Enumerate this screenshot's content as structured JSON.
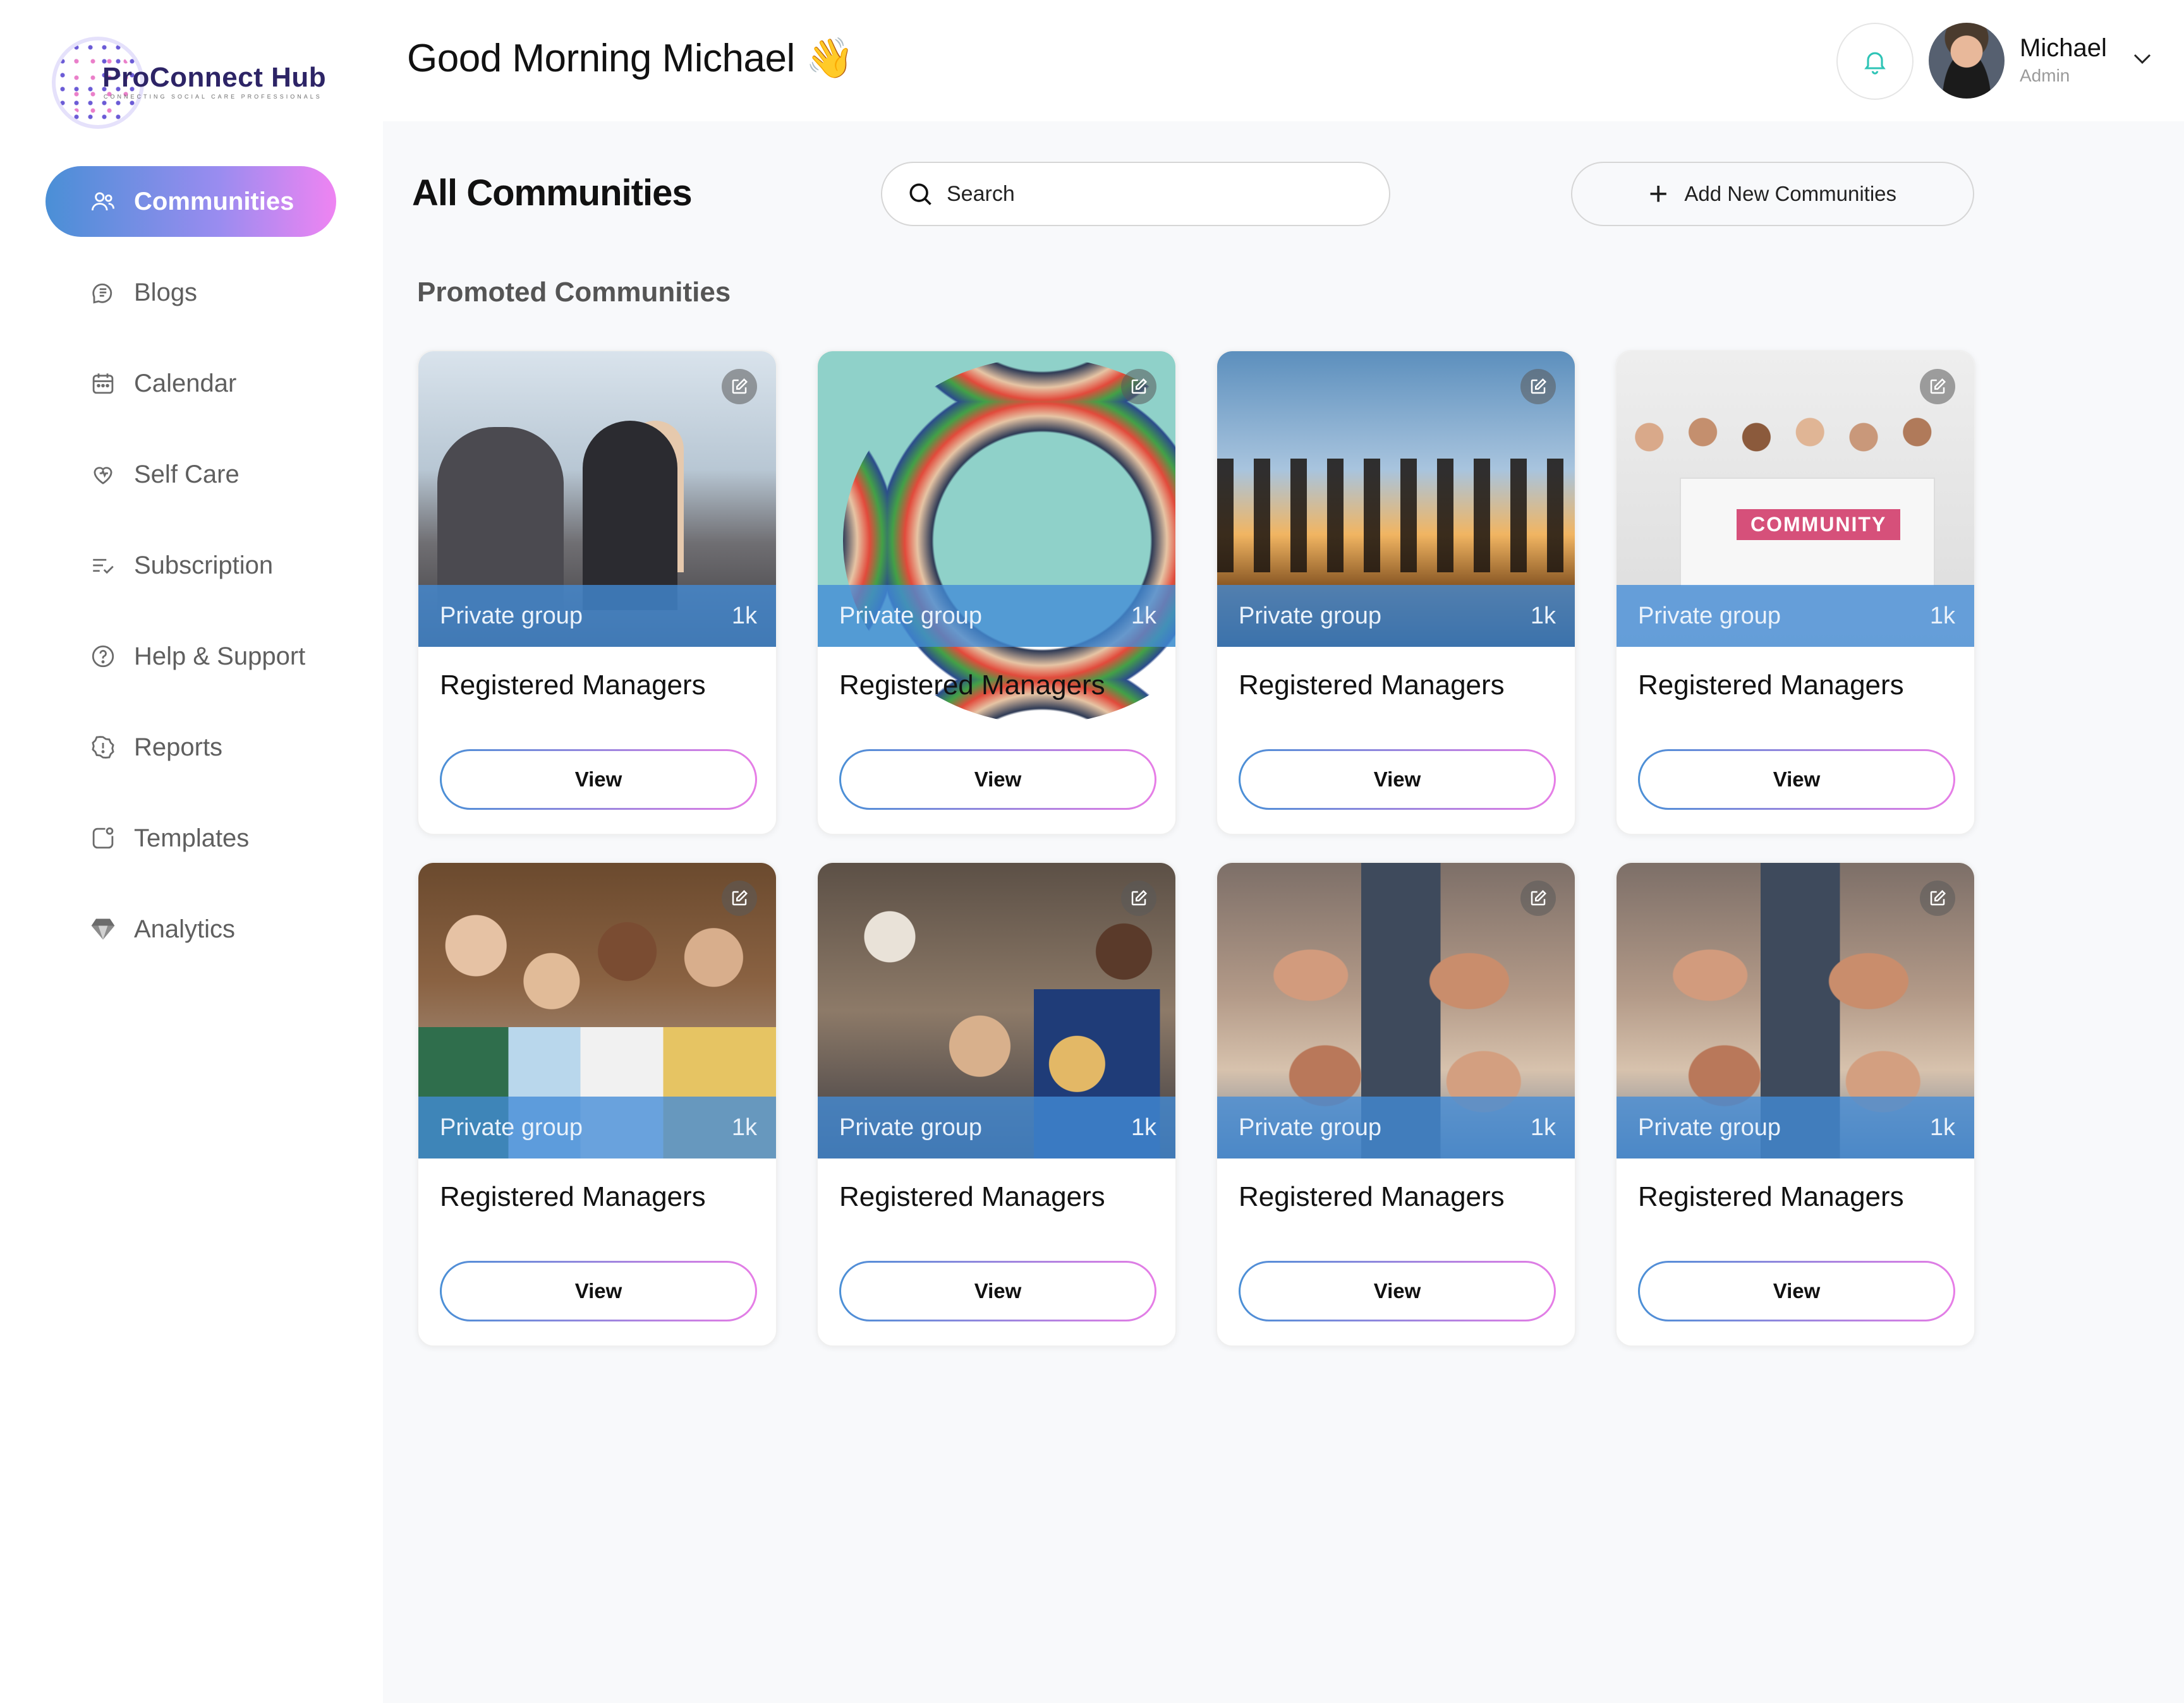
{
  "brand": {
    "name": "ProConnect Hub",
    "tagline": "CONNECTING SOCIAL CARE PROFESSIONALS"
  },
  "header": {
    "greeting": "Good Morning Michael",
    "greeting_emoji": "👋"
  },
  "user": {
    "name": "Michael",
    "role": "Admin"
  },
  "sidebar": {
    "items": [
      {
        "label": "Communities",
        "icon": "users-icon",
        "active": true
      },
      {
        "label": "Blogs",
        "icon": "blog-icon",
        "active": false
      },
      {
        "label": "Calendar",
        "icon": "calendar-icon",
        "active": false
      },
      {
        "label": "Self Care",
        "icon": "heart-icon",
        "active": false
      },
      {
        "label": "Subscription",
        "icon": "list-check-icon",
        "active": false
      },
      {
        "label": "Help & Support",
        "icon": "question-icon",
        "active": false
      },
      {
        "label": "Reports",
        "icon": "alert-icon",
        "active": false
      },
      {
        "label": "Templates",
        "icon": "template-icon",
        "active": false
      },
      {
        "label": "Analytics",
        "icon": "diamond-icon",
        "active": false
      }
    ]
  },
  "main": {
    "title": "All Communities",
    "search": {
      "placeholder": "Search",
      "value": ""
    },
    "add_button": "Add New Communities",
    "section_title": "Promoted Communities",
    "cards": [
      {
        "type": "Private group",
        "members": "1k",
        "name": "Registered Managers",
        "action": "View",
        "image": "office-meeting"
      },
      {
        "type": "Private group",
        "members": "1k",
        "name": "Registered Managers",
        "action": "View",
        "image": "people-circle"
      },
      {
        "type": "Private group",
        "members": "1k",
        "name": "Registered Managers",
        "action": "View",
        "image": "skyline-silhouettes"
      },
      {
        "type": "Private group",
        "members": "1k",
        "name": "Registered Managers",
        "action": "View",
        "image": "community-sign"
      },
      {
        "type": "Private group",
        "members": "1k",
        "name": "Registered Managers",
        "action": "View",
        "image": "group-portrait"
      },
      {
        "type": "Private group",
        "members": "1k",
        "name": "Registered Managers",
        "action": "View",
        "image": "networking-event"
      },
      {
        "type": "Private group",
        "members": "1k",
        "name": "Registered Managers",
        "action": "View",
        "image": "fist-bump"
      },
      {
        "type": "Private group",
        "members": "1k",
        "name": "Registered Managers",
        "action": "View",
        "image": "fist-bump"
      }
    ]
  },
  "colors": {
    "accent_gradient_start": "#4a8fd6",
    "accent_gradient_end": "#ef84f2",
    "overlay_blue": "#428cd7",
    "bell_teal": "#2ec4b6"
  }
}
